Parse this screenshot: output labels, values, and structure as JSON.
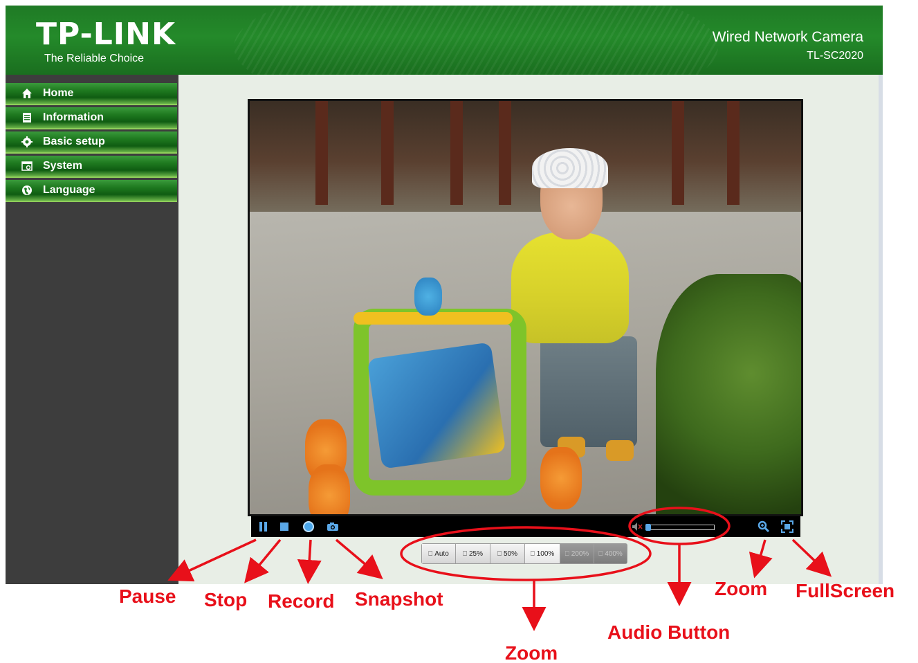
{
  "header": {
    "logo": "TP-LINK",
    "tagline": "The Reliable Choice",
    "product_name": "Wired Network Camera",
    "product_model": "TL-SC2020"
  },
  "sidebar": {
    "items": [
      {
        "label": "Home",
        "icon": "home-icon"
      },
      {
        "label": "Information",
        "icon": "document-icon"
      },
      {
        "label": "Basic setup",
        "icon": "gear-icon"
      },
      {
        "label": "System",
        "icon": "system-icon"
      },
      {
        "label": "Language",
        "icon": "globe-icon"
      }
    ]
  },
  "video": {
    "controls": [
      {
        "name": "pause",
        "icon": "pause-icon"
      },
      {
        "name": "stop",
        "icon": "stop-icon"
      },
      {
        "name": "record",
        "icon": "record-icon"
      },
      {
        "name": "snapshot",
        "icon": "camera-icon"
      }
    ],
    "audio": {
      "icon": "speaker-muted-icon",
      "volume": 0
    },
    "right_controls": [
      {
        "name": "zoom",
        "icon": "magnifier-icon"
      },
      {
        "name": "fullscreen",
        "icon": "fullscreen-icon"
      }
    ]
  },
  "zoom_options": [
    {
      "label": "Auto",
      "state": "normal"
    },
    {
      "label": "25%",
      "state": "normal"
    },
    {
      "label": "50%",
      "state": "normal"
    },
    {
      "label": "100%",
      "state": "active"
    },
    {
      "label": "200%",
      "state": "disabled"
    },
    {
      "label": "400%",
      "state": "disabled"
    }
  ],
  "annotations": {
    "pause": "Pause",
    "stop": "Stop",
    "record": "Record",
    "snapshot": "Snapshot",
    "zoom_bar": "Zoom",
    "audio": "Audio Button",
    "zoom": "Zoom",
    "fullscreen": "FullScreen"
  },
  "colors": {
    "brand_green": "#248a2a",
    "annotation_red": "#e8101a",
    "control_blue": "#5aa8e8"
  }
}
